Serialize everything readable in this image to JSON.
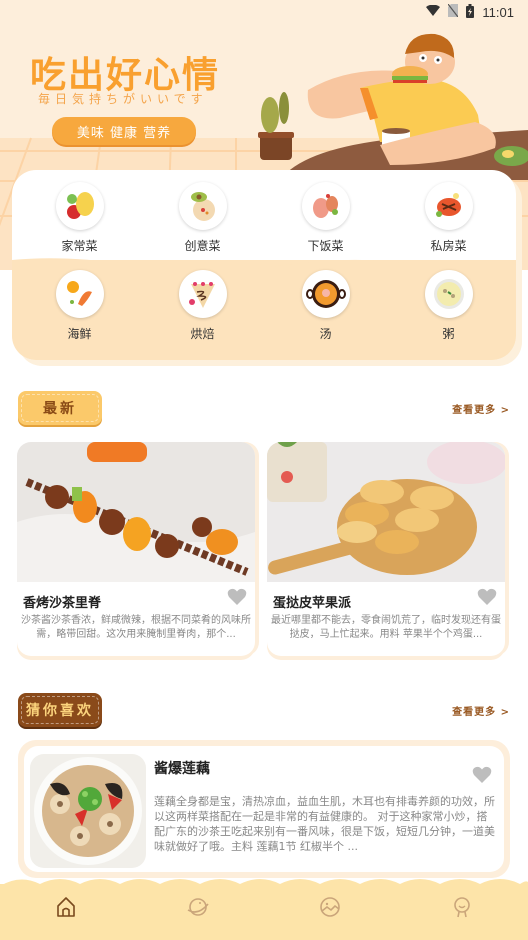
{
  "status_bar": {
    "time": "11:01",
    "icons": [
      "wifi-icon",
      "no-sim-icon",
      "battery-charging-icon"
    ]
  },
  "banner": {
    "headline": "吃出好心情",
    "subline": "毎日気持ちがいいです",
    "tag_button": "美味 健康 营养"
  },
  "categories": [
    {
      "label": "家常菜",
      "icon": "home-dish-icon"
    },
    {
      "label": "创意菜",
      "icon": "creative-dish-icon"
    },
    {
      "label": "下饭菜",
      "icon": "rice-dish-icon"
    },
    {
      "label": "私房菜",
      "icon": "private-dish-icon"
    },
    {
      "label": "海鲜",
      "icon": "seafood-icon"
    },
    {
      "label": "烘焙",
      "icon": "baking-icon"
    },
    {
      "label": "汤",
      "icon": "soup-icon"
    },
    {
      "label": "粥",
      "icon": "porridge-icon"
    }
  ],
  "newest": {
    "title": "最新",
    "more": "查看更多 >",
    "items": [
      {
        "title": "香烤沙茶里脊",
        "desc": "沙茶酱沙茶香浓，鲜咸微辣，根据不同菜肴的风味所需，略带回甜。这次用来腌制里脊肉，那个..."
      },
      {
        "title": "蛋挞皮苹果派",
        "desc": "最近哪里都不能去，零食闹饥荒了，临时发现还有蛋挞皮，马上忙起来。用料 苹果半个个鸡蛋..."
      }
    ]
  },
  "guess": {
    "title": "猜你喜欢",
    "more": "查看更多 >",
    "item": {
      "title": "酱爆莲藕",
      "desc": "莲藕全身都是宝，清热凉血，益血生肌，木耳也有排毒养颜的功效，所以这两样菜搭配在一起是非常的有益健康的。 对于这种家常小炒，搭配广东的沙茶王吃起来别有一番风味，很是下饭，短短几分钟，一道美味就做好了哦。主料   莲藕1节   红椒半个   ..."
    }
  },
  "bottom_nav": {
    "items": [
      {
        "name": "home",
        "icon": "home-icon",
        "active": true
      },
      {
        "name": "discover",
        "icon": "planet-icon",
        "active": false
      },
      {
        "name": "gallery",
        "icon": "image-icon",
        "active": false
      },
      {
        "name": "profile",
        "icon": "user-icon",
        "active": false
      }
    ]
  },
  "colors": {
    "accent": "#f7a83e",
    "brown": "#8a4a1a",
    "cream": "#fdeedb",
    "peach": "#fde3bd",
    "nav_bg": "#fde4a9"
  }
}
